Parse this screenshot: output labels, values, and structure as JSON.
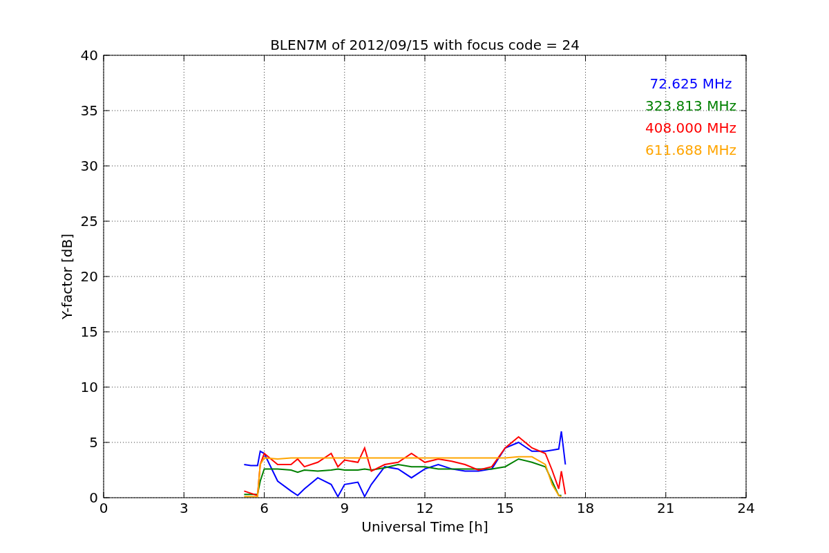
{
  "figure": {
    "chart_data": {
      "type": "line",
      "title": "BLEN7M of 2012/09/15 with focus code = 24",
      "xlabel": "Universal Time [h]",
      "ylabel": "Y-factor [dB]",
      "x": [
        5.25,
        5.5,
        5.75,
        5.85,
        6,
        6.5,
        7,
        7.25,
        7.5,
        8,
        8.5,
        8.75,
        9,
        9.5,
        9.75,
        10,
        10.5,
        11,
        11.5,
        12,
        12.5,
        13,
        13.5,
        14,
        14.5,
        15,
        15.5,
        16,
        16.5,
        16.75,
        17,
        17.1,
        17.25
      ],
      "series": [
        {
          "name": "72.625 MHz",
          "color": "#0000ff",
          "values": [
            3,
            2.9,
            2.9,
            4.2,
            4,
            1.5,
            0.6,
            0.2,
            0.8,
            1.8,
            1.2,
            0.1,
            1.2,
            1.4,
            0.1,
            1.2,
            2.8,
            2.6,
            1.8,
            2.6,
            3,
            2.6,
            2.4,
            2.4,
            2.6,
            4.5,
            5,
            4.2,
            4.2,
            4.3,
            4.4,
            6,
            3
          ]
        },
        {
          "name": "323.813 MHz",
          "color": "#008000",
          "values": [
            0.3,
            0.3,
            0.3,
            1.5,
            2.6,
            2.6,
            2.5,
            2.3,
            2.5,
            2.4,
            2.5,
            2.6,
            2.5,
            2.5,
            2.6,
            2.5,
            2.7,
            3,
            2.8,
            2.8,
            2.6,
            2.6,
            2.6,
            2.6,
            2.6,
            2.8,
            3.5,
            3.2,
            2.8,
            1.5,
            0.2,
            0.2,
            null
          ]
        },
        {
          "name": "408.000 MHz",
          "color": "#ff0000",
          "values": [
            0.6,
            0.4,
            0.2,
            3,
            4,
            3,
            3,
            3.5,
            2.8,
            3.2,
            4,
            2.8,
            3.4,
            3.2,
            4.5,
            2.4,
            3,
            3.2,
            4,
            3.2,
            3.5,
            3.3,
            3,
            2.5,
            2.8,
            4.5,
            5.5,
            4.5,
            4,
            2.5,
            0.8,
            2.4,
            0.3
          ]
        },
        {
          "name": "611.688 MHz",
          "color": "#ffa500",
          "values": [
            0.1,
            0.1,
            0.1,
            3,
            3.6,
            3.5,
            3.6,
            3.6,
            3.6,
            3.6,
            3.6,
            3.6,
            3.6,
            3.6,
            3.6,
            3.6,
            3.6,
            3.6,
            3.6,
            3.6,
            3.6,
            3.6,
            3.6,
            3.6,
            3.6,
            3.6,
            3.7,
            3.7,
            3,
            1.2,
            0.2,
            0.1,
            null
          ]
        }
      ],
      "grid": true,
      "xlim": [
        0,
        24
      ],
      "ylim": [
        0,
        40
      ],
      "xticks": [
        0,
        3,
        6,
        9,
        12,
        15,
        18,
        21,
        24
      ],
      "yticks": [
        0,
        5,
        10,
        15,
        20,
        25,
        30,
        35,
        40
      ]
    }
  }
}
